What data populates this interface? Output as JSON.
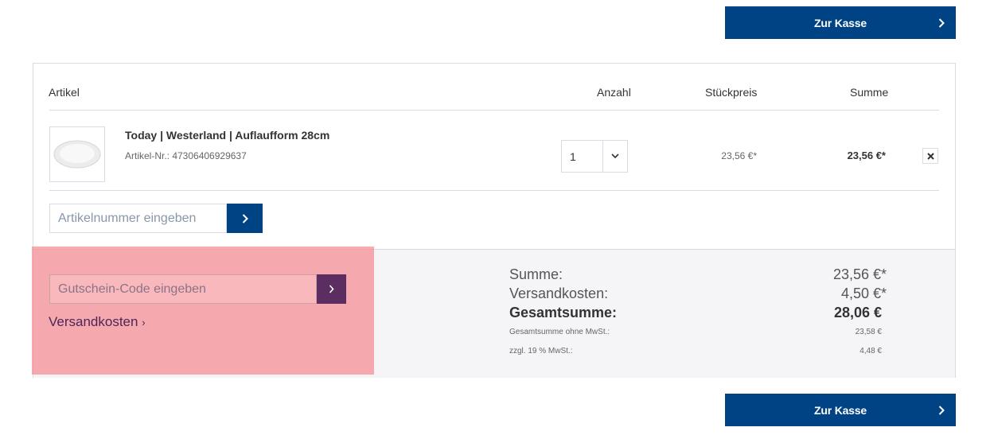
{
  "checkout_label": "Zur Kasse",
  "table": {
    "headers": {
      "article": "Artikel",
      "quantity": "Anzahl",
      "unit_price": "Stückpreis",
      "total": "Summe"
    }
  },
  "item": {
    "title": "Today | Westerland | Auflaufform 28cm",
    "article_number": "Artikel-Nr.: 47306406929637",
    "quantity": "1",
    "unit_price": "23,56 €*",
    "line_total": "23,56 €*"
  },
  "article_input": {
    "placeholder": "Artikelnummer eingeben"
  },
  "voucher_input": {
    "placeholder": "Gutschein-Code eingeben"
  },
  "shipping_link": "Versandkosten",
  "summary": {
    "subtotal_label": "Summe:",
    "subtotal_value": "23,56 €*",
    "shipping_label": "Versandkosten:",
    "shipping_value": "4,50 €*",
    "grand_label": "Gesamtsumme:",
    "grand_value": "28,06 €",
    "net_label": "Gesamtsumme ohne MwSt.:",
    "net_value": "23,58 €",
    "tax_label": "zzgl. 19 % MwSt.:",
    "tax_value": "4,48 €"
  },
  "colors": {
    "primary": "#004385",
    "voucher_button": "#5b2d61",
    "highlight": "#f58c91"
  }
}
